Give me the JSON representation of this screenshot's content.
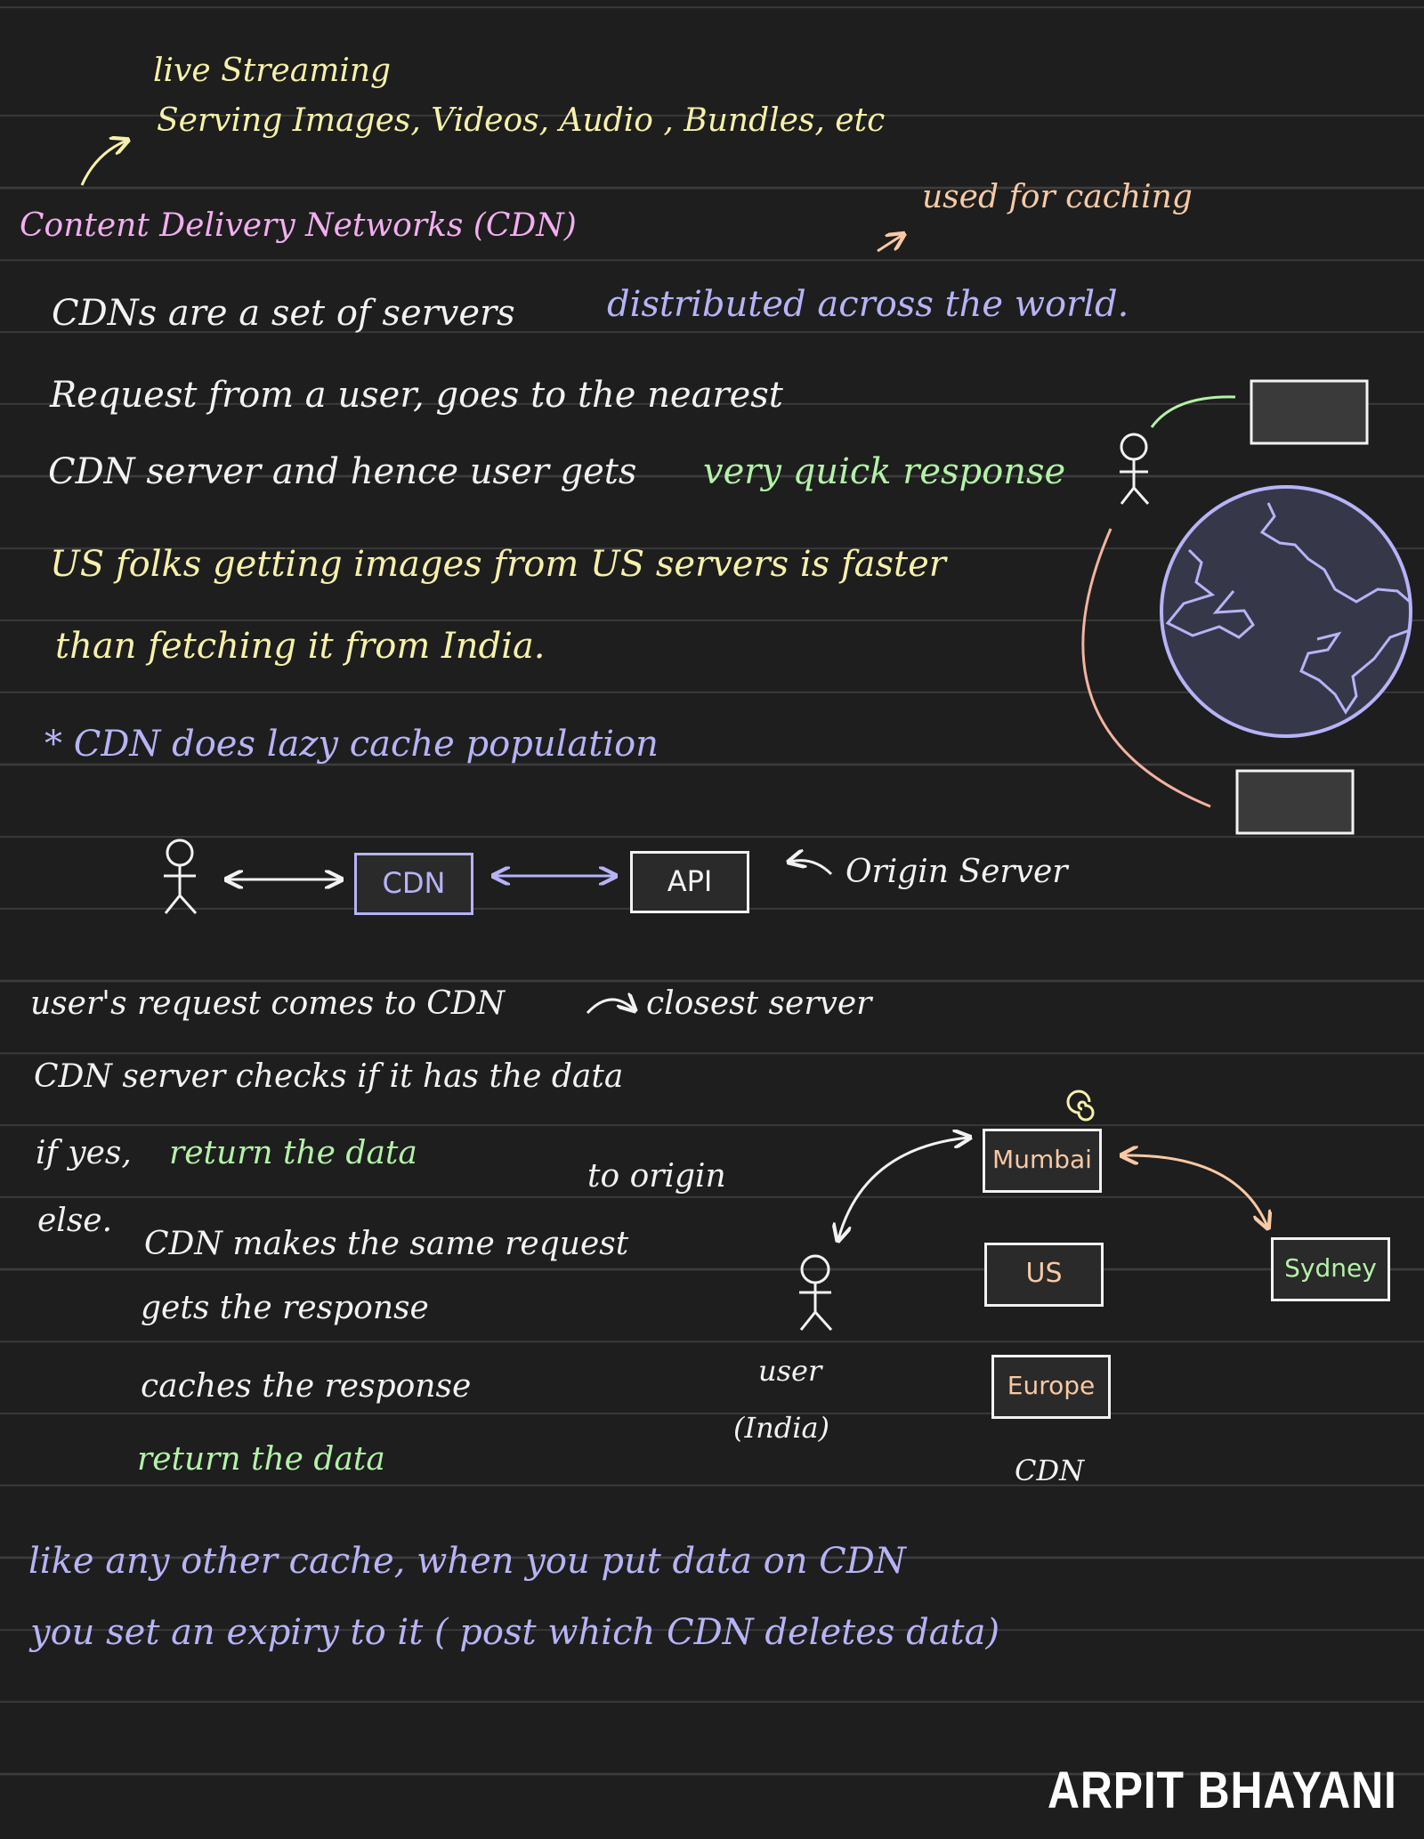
{
  "header": {
    "line1": "live Streaming",
    "line2": "Serving Images, Videos, Audio ,  Bundles, etc"
  },
  "title": "Content Delivery Networks (CDN)",
  "used_for": "used for caching",
  "para": {
    "line1_a": "CDNs are a set of servers",
    "line1_b": "distributed across the world.",
    "line2": "Request from a user, goes to the nearest",
    "line3_a": "CDN server and hence user gets",
    "line3_b": "very quick response",
    "line4": "US folks getting images from US servers is faster",
    "line5": "than fetching it from India."
  },
  "lazy": "* CDN does lazy cache population",
  "flow": {
    "cdn_label": "CDN",
    "api_label": "API",
    "origin_label": "Origin Server"
  },
  "steps": {
    "s1_a": "user's request comes to CDN",
    "s1_b": "closest server",
    "s2": "CDN server checks if it has the data",
    "s3_a": "if yes,",
    "s3_b": "return the data",
    "to_origin": "to origin",
    "else": "else.",
    "s4": "CDN makes the same request",
    "s5": "gets the response",
    "s6": "caches the response",
    "s7": "return the data"
  },
  "regions": {
    "mumbai": "Mumbai",
    "us": "US",
    "sydney": "Sydney",
    "europe": "Europe",
    "cdn_caption": "CDN",
    "user_label": "user",
    "user_loc": "(India)"
  },
  "footer": {
    "line1": "like any other cache, when you put data on CDN",
    "line2": "you set an expiry to it ( post which CDN deletes data)"
  },
  "brand": "ARPIT BHAYANI",
  "colors": {
    "background": "#1e1e1e",
    "rule": "#3c3c3c",
    "yellow": "#f6f1a8",
    "pink": "#f3aef0",
    "lavender": "#b7b3f7",
    "green": "#b3f2a8",
    "orange": "#f8c9a4",
    "white": "#f2f2f2"
  }
}
